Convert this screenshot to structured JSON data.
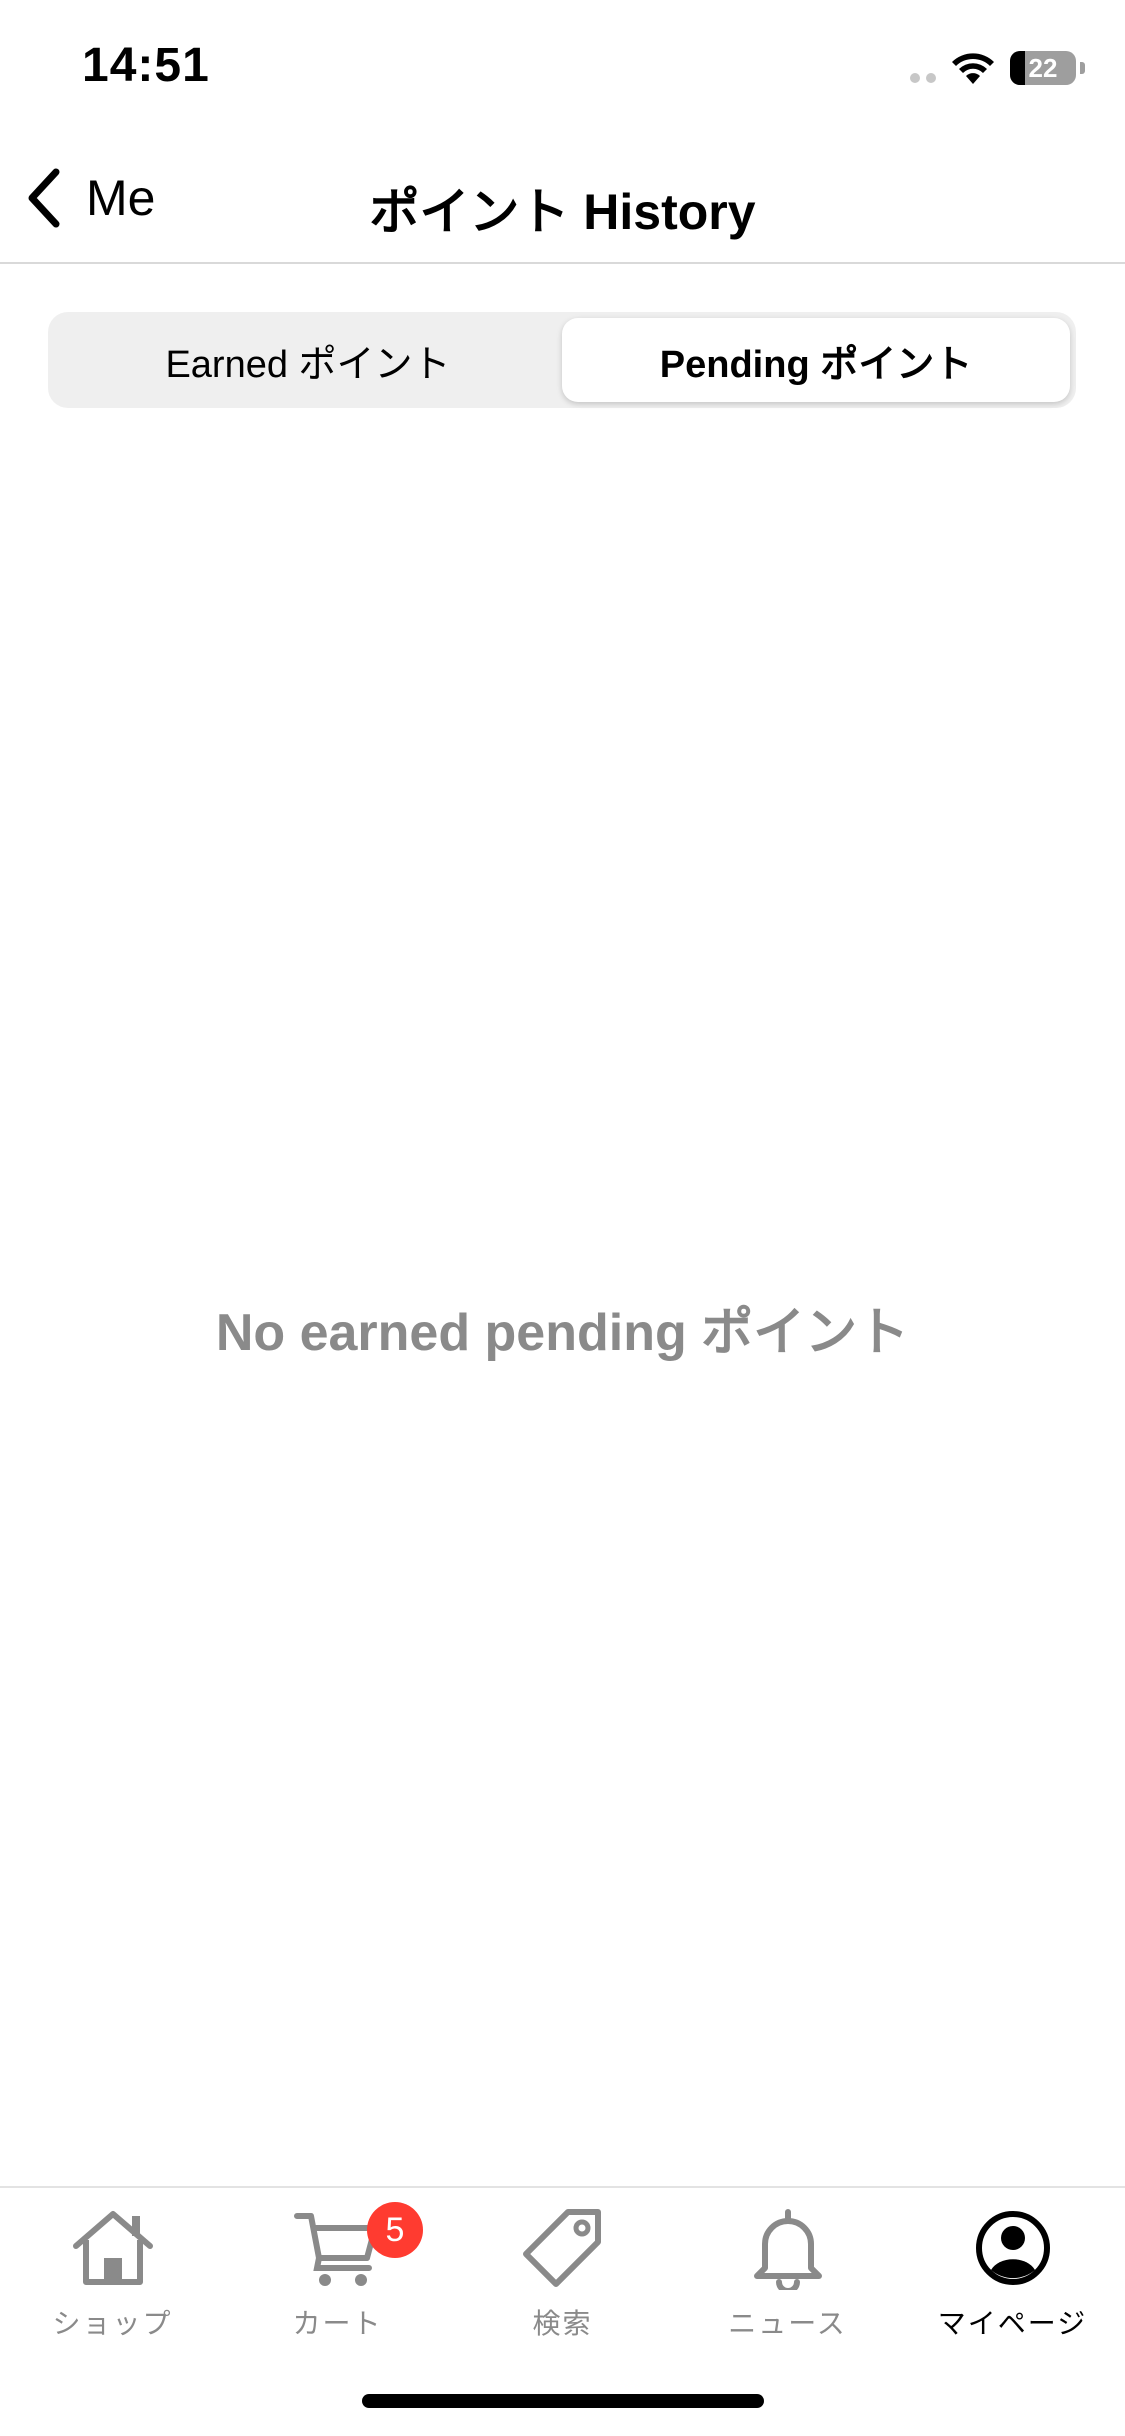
{
  "status_bar": {
    "time": "14:51",
    "battery_level": "22",
    "battery_fraction": 0.22
  },
  "nav": {
    "back_label": "Me",
    "title": "ポイント History"
  },
  "segments": {
    "earned_label": "Earned ポイント",
    "pending_label": "Pending ポイント",
    "selected": "pending"
  },
  "empty_state": {
    "message": "No earned pending ポイント"
  },
  "tab_bar": {
    "items": [
      {
        "label": "ショップ",
        "icon": "house-icon"
      },
      {
        "label": "カート",
        "icon": "cart-icon",
        "badge": "5"
      },
      {
        "label": "検索",
        "icon": "tag-icon"
      },
      {
        "label": "ニュース",
        "icon": "bell-icon"
      },
      {
        "label": "マイページ",
        "icon": "person-circle-icon",
        "active": true
      }
    ]
  },
  "colors": {
    "badge": "#ff3b30",
    "inactive_tab": "#8a8a8a",
    "active_tab": "#000000",
    "segment_bg": "#efefef"
  }
}
